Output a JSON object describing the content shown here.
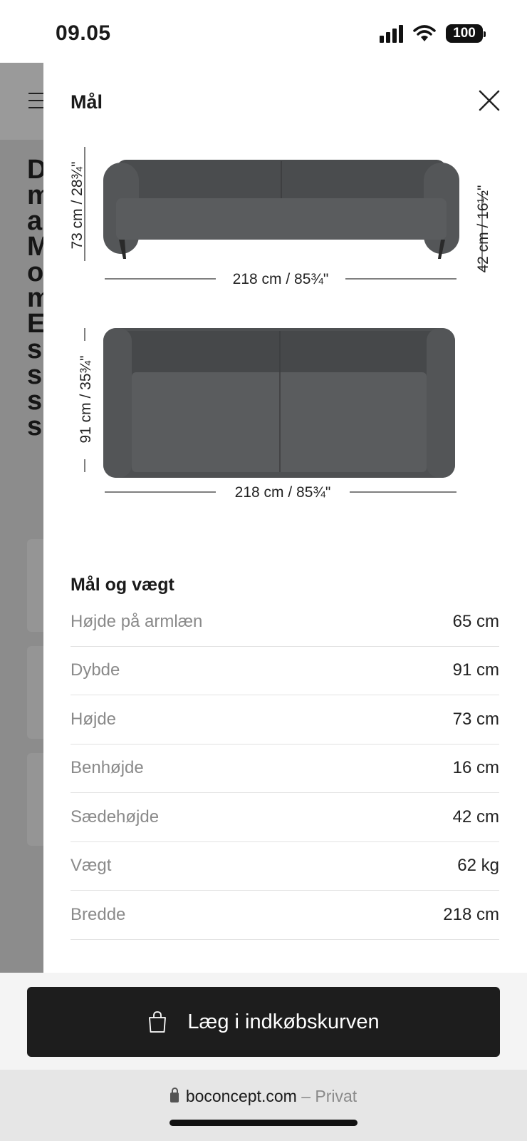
{
  "status_bar": {
    "time": "09.05",
    "battery": "100",
    "icons": [
      "cellular-signal-icon",
      "wifi-icon",
      "battery-icon"
    ]
  },
  "background_page": {
    "headline_letters": [
      "D",
      "m",
      "a",
      "M",
      "o",
      "m",
      "E",
      "s",
      "s",
      "s",
      "s"
    ]
  },
  "drawer": {
    "title": "Mål",
    "front_view": {
      "height_label": "73 cm / 28¾\"",
      "seat_height_label": "42 cm / 16½\"",
      "width_label": "218 cm / 85¾\""
    },
    "top_view": {
      "depth_label": "91 cm / 35¾\"",
      "width_label": "218 cm / 85¾\""
    },
    "specs_heading": "Mål og vægt",
    "specs": [
      {
        "label": "Højde på armlæn",
        "value": "65 cm"
      },
      {
        "label": "Dybde",
        "value": "91 cm"
      },
      {
        "label": "Højde",
        "value": "73 cm"
      },
      {
        "label": "Benhøjde",
        "value": "16 cm"
      },
      {
        "label": "Sædehøjde",
        "value": "42 cm"
      },
      {
        "label": "Vægt",
        "value": "62 kg"
      },
      {
        "label": "Bredde",
        "value": "218 cm"
      }
    ]
  },
  "action": {
    "cart_label": "Læg i indkøbskurven"
  },
  "browser": {
    "domain": "boconcept.com",
    "mode": "– Privat"
  },
  "colors": {
    "sofa": "#505254",
    "button": "#1d1d1d",
    "overlay": "#8c8c8c"
  }
}
